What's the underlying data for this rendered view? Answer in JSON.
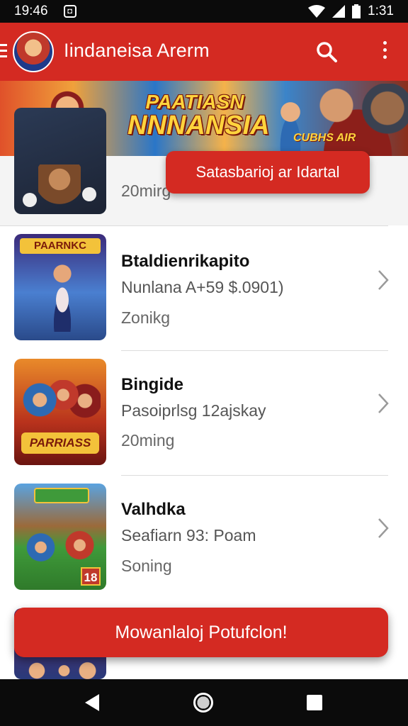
{
  "status_bar": {
    "time_left": "19:46",
    "time_right": "1:31"
  },
  "app_bar": {
    "title": "Iindaneisa Arerm"
  },
  "banner": {
    "logo_line1": "PAATIASN",
    "logo_line2": "NNNANSIA",
    "tag": "CUBHS AIR"
  },
  "toast_top": "Satasbarioj ar Idartal",
  "items": [
    {
      "title": "",
      "subtitle": "",
      "meta": "20mirg"
    },
    {
      "title": "Btaldienrikapito",
      "subtitle": "Nunlana A+59 $.0901)",
      "meta": "Zonikg"
    },
    {
      "title": "Bingide",
      "subtitle": "Pasoiprlsg 12ajskay",
      "meta": "20ming"
    },
    {
      "title": "Valhdka",
      "subtitle": "Seafiarn 93: Poam",
      "meta": "Soning"
    }
  ],
  "thumb_labels": {
    "item2": "PAARNKC",
    "item3": "PARRIASS",
    "item4_badge": "18"
  },
  "toast_bottom": "Mowanlaloj Potufclon!",
  "colors": {
    "accent": "#d42a22",
    "bars": "#0b0b0b"
  },
  "icons": [
    "menu-icon",
    "search-icon",
    "more-vert-icon",
    "chevron-right-icon",
    "back-icon",
    "home-icon",
    "recents-icon"
  ]
}
